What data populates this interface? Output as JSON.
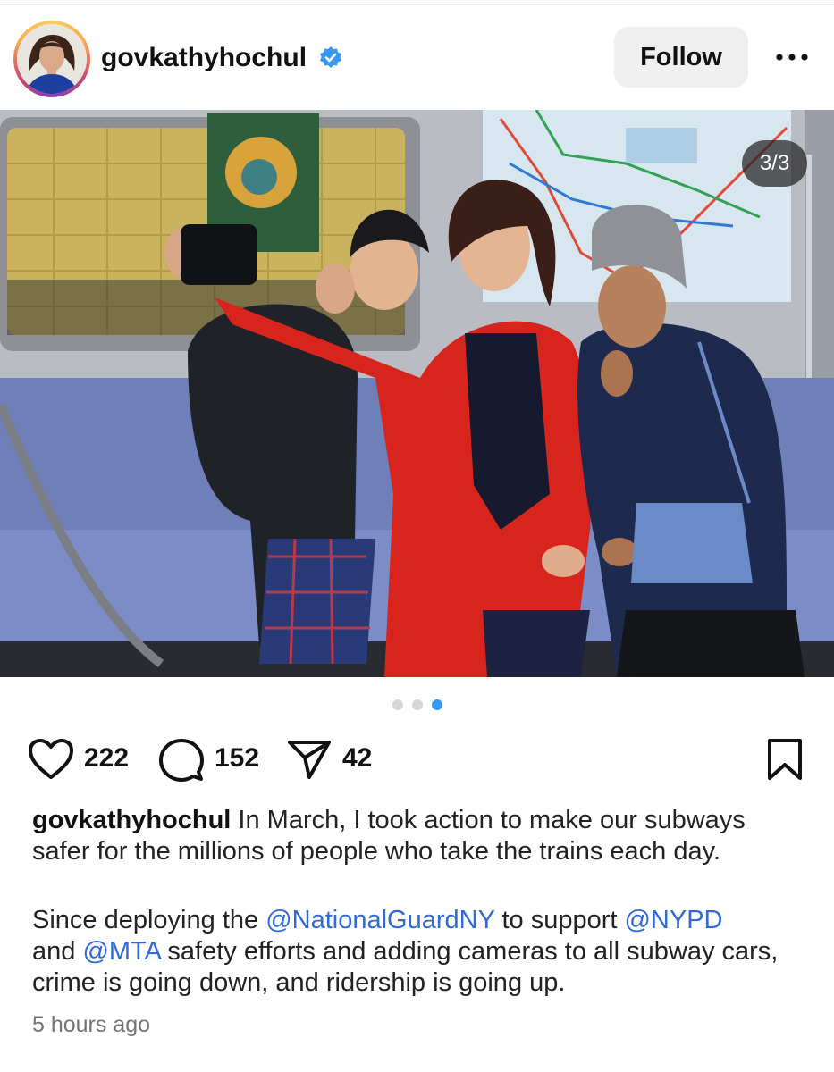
{
  "post": {
    "username": "govkathyhochul",
    "verified": true,
    "follow_label": "Follow",
    "more_icon": "more-horizontal-icon",
    "media": {
      "counter": "3/3",
      "current_index": 3,
      "total": 3
    },
    "likes": "222",
    "comments": "152",
    "shares": "42",
    "caption": {
      "username": "govkathyhochul",
      "line1": "In March, I took action to make our subways safer for the millions of people who take the trains each day.",
      "p2_text1": "Since deploying the ",
      "mention1": "@NationalGuardNY",
      "p2_text2": " to support ",
      "mention2": "@NYPD",
      "p2_text3": " and ",
      "mention3": "@MTA",
      "p2_text4": " safety efforts and adding cameras to all subway cars, crime is going down, and ridership is going up."
    },
    "timestamp": "5 hours ago"
  },
  "colors": {
    "accent_blue": "#3897f0",
    "mention_blue": "#2e6ad8",
    "follow_bg": "#efefef",
    "dot_inactive": "#d6d6d6"
  }
}
